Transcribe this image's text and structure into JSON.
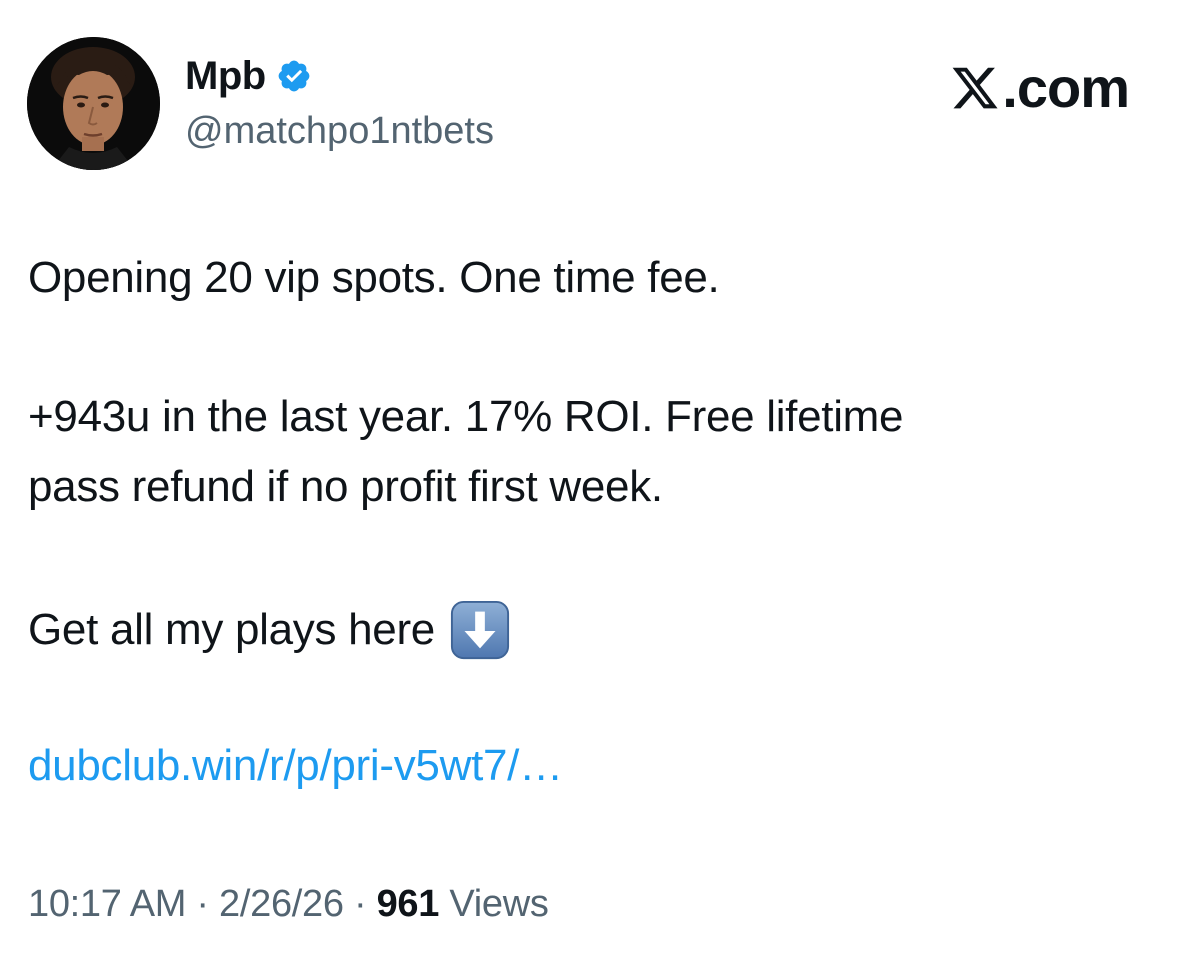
{
  "author": {
    "display_name": "Mpb",
    "handle": "@matchpo1ntbets",
    "verified": true,
    "verified_color": "#1d9bf0"
  },
  "site_logo": {
    "icon": "x-logo-icon",
    "text": ".com"
  },
  "tweet": {
    "line1": "Opening 20 vip spots. One time fee.",
    "line2": "+943u in the last year. 17% ROI. Free lifetime",
    "line3": "pass refund if no profit first week.",
    "line4": "Get all my plays here",
    "line4_emoji": "down-arrow-emoji-icon",
    "link_text": "dubclub.win/r/p/pri-v5wt7/…",
    "link_color": "#1d9bf0"
  },
  "meta": {
    "time": "10:17 AM",
    "separator": " · ",
    "date": "2/26/26",
    "views_count": "961",
    "views_label": "Views"
  }
}
